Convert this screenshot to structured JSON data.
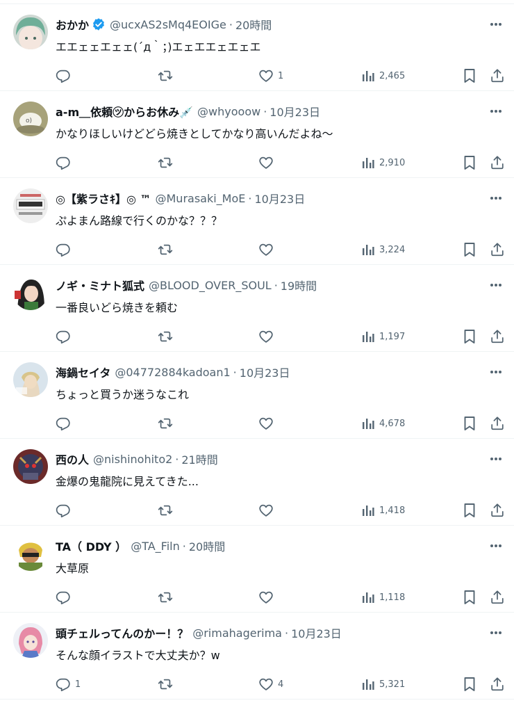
{
  "colors": {
    "text": "#0f1419",
    "muted": "#536471",
    "verified": "#1d9bf0",
    "border": "#eff3f4"
  },
  "icons": {
    "reply": "reply-icon",
    "retweet": "retweet-icon",
    "like": "heart-icon",
    "views": "views-icon",
    "bookmark": "bookmark-icon",
    "share": "share-icon",
    "more": "more-icon",
    "verified": "verified-badge-icon"
  },
  "tweets": [
    {
      "name": "おかか",
      "verified": true,
      "handle": "@ucxAS2sMq4EOIGe",
      "dot": "·",
      "time": "20時間",
      "text": "エエェェエェェ(´д｀；)エェエエェエェエ",
      "replies": "",
      "retweets": "",
      "likes": "1",
      "views": "2,465"
    },
    {
      "name": "a-m＿依頼㋡からお休み💉",
      "verified": false,
      "handle": "@whyooow",
      "dot": "·",
      "time": "10月23日",
      "text": "かなりほしいけどどら焼きとしてかなり高いんだよね～",
      "replies": "",
      "retweets": "",
      "likes": "",
      "views": "2,910"
    },
    {
      "name": "◎【紫ラさｷ】◎ ™",
      "verified": false,
      "handle": "@Murasaki_MoE",
      "dot": "·",
      "time": "10月23日",
      "text": "ぷよまん路線で行くのかな？？？",
      "replies": "",
      "retweets": "",
      "likes": "",
      "views": "3,224"
    },
    {
      "name": "ノギ・ミナト狐式",
      "verified": false,
      "handle": "@BLOOD_OVER_SOUL",
      "dot": "·",
      "time": "19時間",
      "text": "一番良いどら焼きを頼む",
      "replies": "",
      "retweets": "",
      "likes": "",
      "views": "1,197"
    },
    {
      "name": "海鍋セイタ",
      "verified": false,
      "handle": "@04772884kadoan1",
      "dot": "·",
      "time": "10月23日",
      "text": "ちょっと買うか迷うなこれ",
      "replies": "",
      "retweets": "",
      "likes": "",
      "views": "4,678"
    },
    {
      "name": "西の人",
      "verified": false,
      "handle": "@nishinohito2",
      "dot": "·",
      "time": "21時間",
      "text": "金爆の鬼龍院に見えてきた...",
      "replies": "",
      "retweets": "",
      "likes": "",
      "views": "1,418"
    },
    {
      "name": "TA（ DDY ）",
      "verified": false,
      "handle": "@TA_Filn",
      "dot": "·",
      "time": "20時間",
      "text": "大草原",
      "replies": "",
      "retweets": "",
      "likes": "",
      "views": "1,118"
    },
    {
      "name": "頭チェルってんのかー！？",
      "verified": false,
      "handle": "@rimahagerima",
      "dot": "·",
      "time": "10月23日",
      "text": "そんな顔イラストで大丈夫か？w",
      "replies": "1",
      "retweets": "",
      "likes": "4",
      "views": "5,321"
    }
  ]
}
